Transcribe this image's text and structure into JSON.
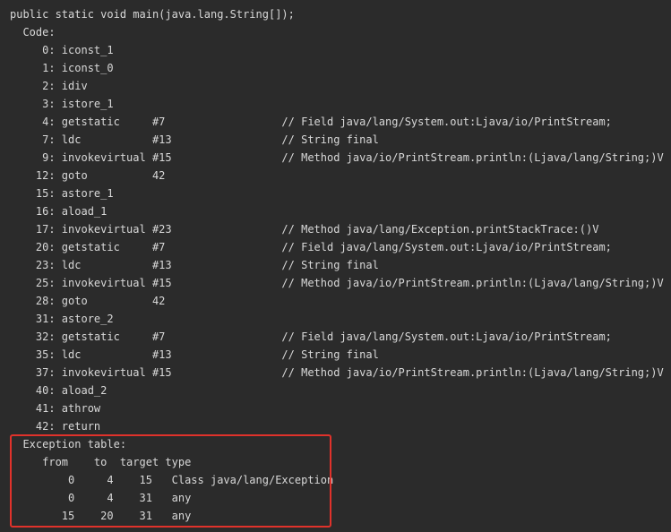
{
  "method_signature": "public static void main(java.lang.String[]);",
  "code_label": "  Code:",
  "instructions": [
    "     0: iconst_1",
    "     1: iconst_0",
    "     2: idiv",
    "     3: istore_1",
    "     4: getstatic     #7                  // Field java/lang/System.out:Ljava/io/PrintStream;",
    "     7: ldc           #13                 // String final",
    "     9: invokevirtual #15                 // Method java/io/PrintStream.println:(Ljava/lang/String;)V",
    "    12: goto          42",
    "    15: astore_1",
    "    16: aload_1",
    "    17: invokevirtual #23                 // Method java/lang/Exception.printStackTrace:()V",
    "    20: getstatic     #7                  // Field java/lang/System.out:Ljava/io/PrintStream;",
    "    23: ldc           #13                 // String final",
    "    25: invokevirtual #15                 // Method java/io/PrintStream.println:(Ljava/lang/String;)V",
    "    28: goto          42",
    "    31: astore_2",
    "    32: getstatic     #7                  // Field java/lang/System.out:Ljava/io/PrintStream;",
    "    35: ldc           #13                 // String final",
    "    37: invokevirtual #15                 // Method java/io/PrintStream.println:(Ljava/lang/String;)V",
    "    40: aload_2",
    "    41: athrow",
    "    42: return"
  ],
  "exception_table": {
    "label": "  Exception table:",
    "header": "     from    to  target type",
    "rows": [
      "         0     4    15   Class java/lang/Exception",
      "         0     4    31   any",
      "        15    20    31   any"
    ]
  },
  "highlight_color": "#e0322b"
}
